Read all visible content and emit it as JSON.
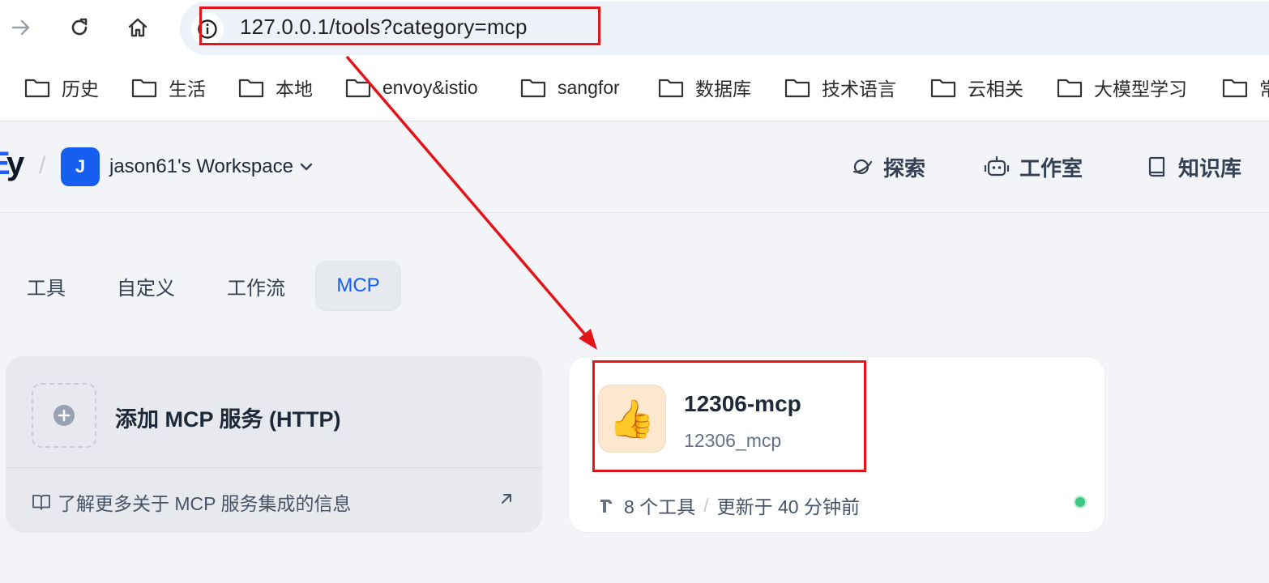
{
  "browser": {
    "url": "127.0.0.1/tools?category=mcp",
    "bookmarks": [
      {
        "label": "历史"
      },
      {
        "label": "生活"
      },
      {
        "label": "本地"
      },
      {
        "label": "envoy&istio"
      },
      {
        "label": "sangfor"
      },
      {
        "label": "数据库"
      },
      {
        "label": "技术语言"
      },
      {
        "label": "云相关"
      },
      {
        "label": "大模型学习"
      },
      {
        "label": "常"
      }
    ]
  },
  "header": {
    "logo_fragment": "y",
    "logo_fragment_accent": "E",
    "workspace_initial": "J",
    "workspace_name": "jason61's Workspace",
    "nav": [
      {
        "label": "探索"
      },
      {
        "label": "工作室"
      },
      {
        "label": "知识库"
      }
    ]
  },
  "tabs": [
    {
      "label": "工具"
    },
    {
      "label": "自定义"
    },
    {
      "label": "工作流"
    },
    {
      "label": "MCP"
    }
  ],
  "add_card": {
    "title": "添加 MCP 服务 (HTTP)",
    "link": "了解更多关于 MCP 服务集成的信息"
  },
  "mcp_card": {
    "emoji": "👍",
    "name": "12306-mcp",
    "id": "12306_mcp",
    "tools_count": "8 个工具",
    "updated": "更新于 40 分钟前"
  },
  "colors": {
    "accent": "#155eef",
    "annotation": "#e3151b",
    "status": "#3cc782"
  }
}
